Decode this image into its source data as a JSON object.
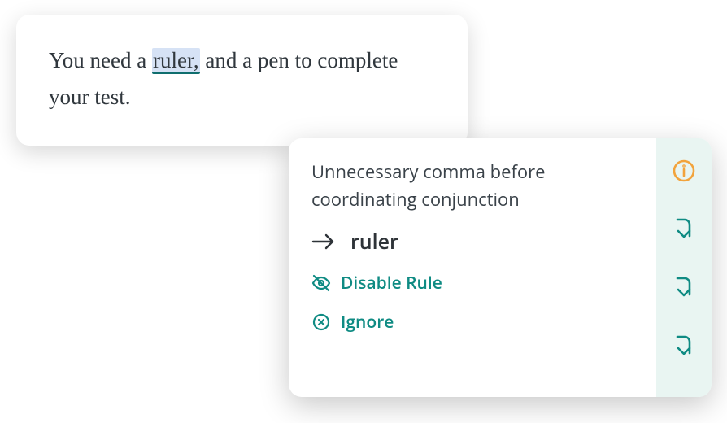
{
  "editor": {
    "prefix": "You need a ",
    "highlighted": "ruler,",
    "suffix": " and a pen to complete your test."
  },
  "popover": {
    "title": "Unnecessary comma before coordinating conjunction",
    "suggestion": "ruler",
    "disable_label": "Disable Rule",
    "ignore_label": "Ignore"
  },
  "icons": {
    "info": "info-icon",
    "nav_down": "arrow-turn-down-icon",
    "arrow_right": "arrow-right-icon",
    "eye_off": "eye-off-icon",
    "close_circle": "close-circle-icon"
  },
  "colors": {
    "teal": "#0f8b83",
    "orange": "#f2a33c",
    "rail_bg": "#e9f5f2",
    "highlight_bg": "#d6e2f5"
  }
}
